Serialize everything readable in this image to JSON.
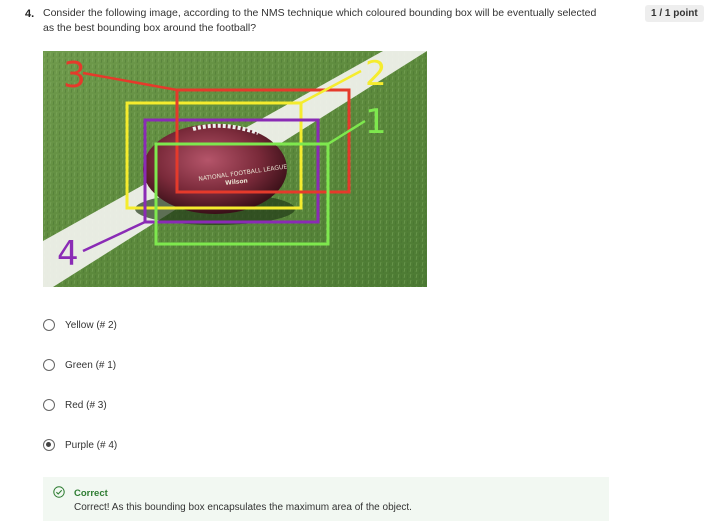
{
  "question": {
    "number": "4.",
    "text": "Consider the following image, according to the NMS technique which coloured bounding box will be eventually selected as the best bounding box around the football?",
    "points": "1 / 1 point"
  },
  "image": {
    "box_labels": [
      "3",
      "2",
      "1",
      "4"
    ],
    "ball_text_1": "NATIONAL FOOTBALL LEAGUE",
    "ball_text_2": "Wilson",
    "colors": {
      "red": "#e53a2b",
      "yellow": "#f5ec2e",
      "green": "#7ee84e",
      "purple": "#8a2bb5"
    }
  },
  "options": [
    {
      "label": "Yellow (# 2)",
      "selected": false
    },
    {
      "label": "Green (# 1)",
      "selected": false
    },
    {
      "label": "Red (# 3)",
      "selected": false
    },
    {
      "label": "Purple (# 4)",
      "selected": true
    }
  ],
  "feedback": {
    "status": "Correct",
    "message": "Correct! As this bounding box encapsulates the maximum area of the object."
  }
}
